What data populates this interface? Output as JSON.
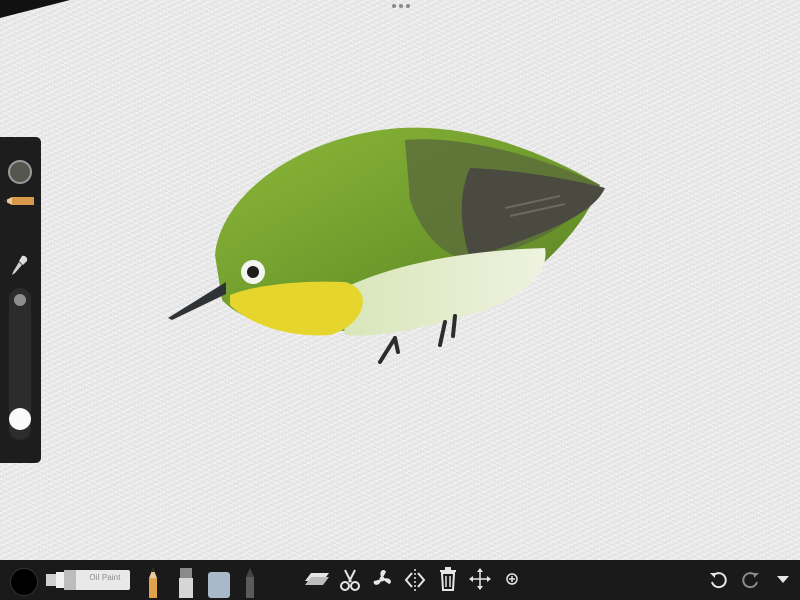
{
  "app": {
    "canvas": {
      "paper_texture": "canvas-texture",
      "painting": "bird-painting"
    },
    "side_panel": {
      "current_color": "#55574f",
      "icons": [
        "color-swatch",
        "pencil-icon",
        "eyedropper-icon"
      ],
      "brush_size_level": 0.05,
      "opacity_level": 1.0
    },
    "bottom_toolbar": {
      "selected_color": "#000000",
      "brush_tube_label": "Oil Paint",
      "tools": [
        "pencil-icon",
        "marker-icon",
        "eraser-icon",
        "crayon-icon"
      ],
      "actions": [
        "layers-icon",
        "scissors-icon",
        "fan-icon",
        "symmetry-icon",
        "trash-icon",
        "move-icon",
        "add-icon"
      ],
      "history": [
        "undo-icon",
        "redo-icon",
        "menu-chevron-icon"
      ]
    }
  }
}
